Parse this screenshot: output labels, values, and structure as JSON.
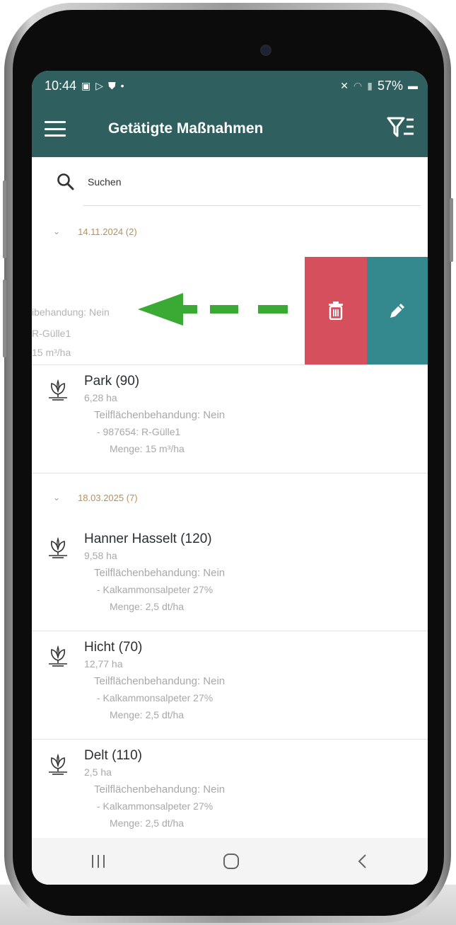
{
  "status": {
    "time": "10:44",
    "battery": "57%"
  },
  "appbar": {
    "title": "Getätigte Maßnahmen"
  },
  "search": {
    "placeholder": "Suchen"
  },
  "groups": [
    {
      "label": "14.11.2024 (2)"
    },
    {
      "label": "18.03.2025 (7)"
    }
  ],
  "swiped": {
    "line1": "ibehandung: Nein",
    "line2": "R-Gülle1",
    "line3": "15 m³/ha"
  },
  "entries": [
    {
      "name": "Park (90)",
      "area": "6,28 ha",
      "line1": "Teilflächenbehandung: Nein",
      "line2": "- 987654: R-Gülle1",
      "line3": "Menge: 15 m³/ha"
    },
    {
      "name": "Hanner Hasselt (120)",
      "area": "9,58 ha",
      "line1": "Teilflächenbehandung: Nein",
      "line2": "- Kalkammonsalpeter 27%",
      "line3": "Menge: 2,5 dt/ha"
    },
    {
      "name": "Hicht (70)",
      "area": "12,77 ha",
      "line1": "Teilflächenbehandung: Nein",
      "line2": "- Kalkammonsalpeter 27%",
      "line3": "Menge: 2,5 dt/ha"
    },
    {
      "name": "Delt (110)",
      "area": "2,5 ha",
      "line1": "Teilflächenbehandung: Nein",
      "line2": "- Kalkammonsalpeter 27%",
      "line3": "Menge: 2,5 dt/ha"
    }
  ],
  "colors": {
    "appbar": "#2f5f5e",
    "delete_action": "#d5505c",
    "edit_action": "#34898e",
    "arrow": "#3aaa35",
    "date_label": "#b8905a"
  },
  "icons": {
    "menu": "menu-icon",
    "filter": "filter-list-icon",
    "search": "search-icon",
    "delete": "trash-icon",
    "edit": "pencil-icon",
    "entry": "plant-icon",
    "swipe_hint": "arrow-left-icon"
  }
}
